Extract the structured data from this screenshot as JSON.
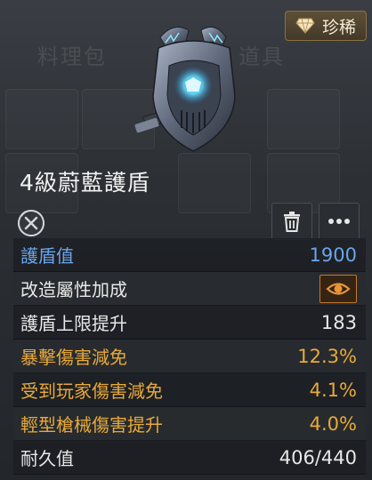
{
  "background": {
    "tabs": [
      "料理包",
      "道具"
    ]
  },
  "rarity_badge": {
    "icon": "diamond-icon",
    "label": "珍稀"
  },
  "item": {
    "name": "4級蔚藍護盾",
    "art_icon": "shield-armor-icon"
  },
  "actions": {
    "delete_icon": "trash-icon",
    "more_icon": "more-dots-icon"
  },
  "stats": [
    {
      "label": "護盾值",
      "value": "1900",
      "style": "blue"
    },
    {
      "label": "改造屬性加成",
      "value": "",
      "style": "normal",
      "icon": "eye-icon"
    },
    {
      "label": "護盾上限提升",
      "value": "183",
      "style": "normal"
    },
    {
      "label": "暴擊傷害減免",
      "value": "12.3%",
      "style": "gold"
    },
    {
      "label": "受到玩家傷害減免",
      "value": "4.1%",
      "style": "gold"
    },
    {
      "label": "輕型槍械傷害提升",
      "value": "4.0%",
      "style": "gold"
    },
    {
      "label": "耐久值",
      "value": "406/440",
      "style": "normal"
    }
  ],
  "colors": {
    "blue": "#69a5ec",
    "gold": "#e8a93a",
    "accent_orange": "#c47a28"
  }
}
